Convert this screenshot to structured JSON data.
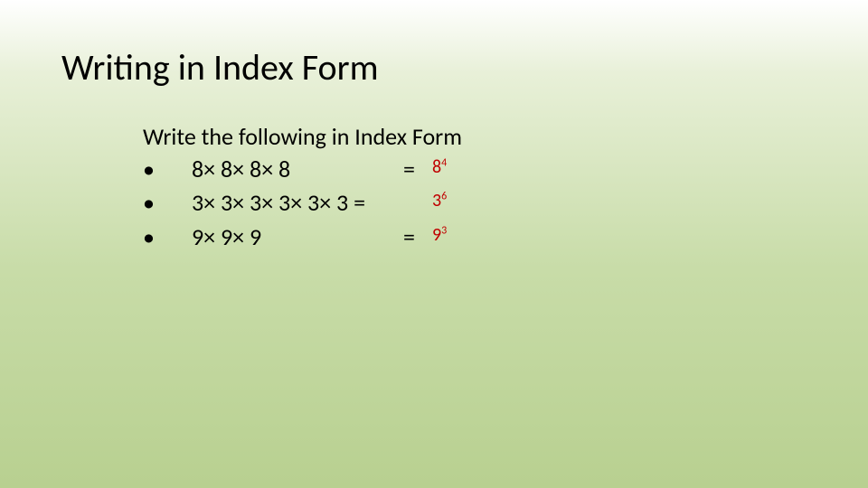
{
  "title": "Writing in Index Form",
  "subheading": "Write the following in Index Form",
  "rows": [
    {
      "bullet": "•",
      "expr": "8× 8× 8× 8",
      "eq": "=",
      "ans_base": "8",
      "ans_exp": "4"
    },
    {
      "bullet": "•",
      "expr": "3× 3× 3× 3× 3× 3  =",
      "eq": "",
      "ans_base": "3",
      "ans_exp": "6"
    },
    {
      "bullet": "•",
      "expr": "9× 9× 9",
      "eq": "=",
      "ans_base": "9",
      "ans_exp": "3"
    }
  ]
}
